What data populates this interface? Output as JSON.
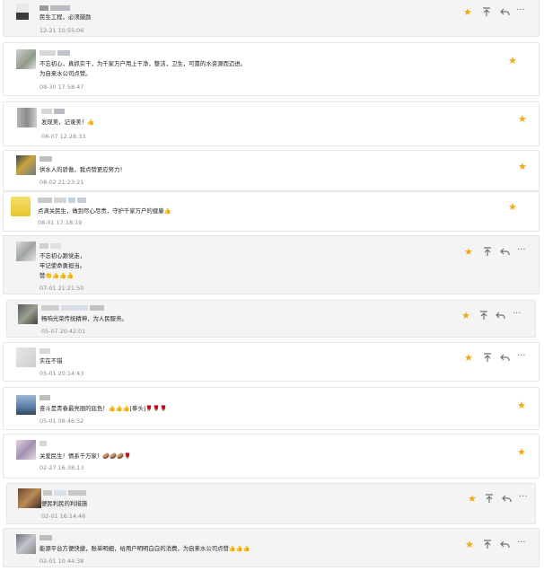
{
  "comments": [
    {
      "text_lines": [
        "民生工程，必须鼓励"
      ],
      "time": "12-21 10:55:06",
      "highlight": true,
      "actions": true
    },
    {
      "text_lines": [
        "不忘初心，真抓实干，为千家万户用上干净，整洁，卫生，可靠的水资源而迈进。",
        "为自来水公司点赞。"
      ],
      "time": "08-30 17:58:47",
      "highlight": false,
      "actions": false
    },
    {
      "text_lines": [
        "发现美，记录美！👍"
      ],
      "time": "08-07 12:28:33",
      "highlight": false,
      "actions": false
    },
    {
      "text_lines": [
        "供水人的骄傲，我点赞更应努力！"
      ],
      "time": "08-02 21:23:21",
      "highlight": false,
      "actions": false
    },
    {
      "text_lines": [
        "点滴关民生，做到尽心尽责，守护千家万户的健康👍"
      ],
      "time": "08-01 17:18:19",
      "highlight": false,
      "actions": false
    },
    {
      "text_lines": [
        "不忘初心跟党走，",
        "牢记使命勇担当。",
        "赞👏👍👍👍"
      ],
      "time": "07-01 21:21:50",
      "highlight": true,
      "actions": true
    },
    {
      "text_lines": [
        "畅响光荣传统精神，为人民服务。"
      ],
      "time": "05-07 20:42:01",
      "highlight": true,
      "actions": true
    },
    {
      "text_lines": [
        "实在不错"
      ],
      "time": "05-01 20:14:43",
      "highlight": false,
      "actions": true
    },
    {
      "text_lines": [
        "奋斗是青春最亮丽的底色！👍👍👍[拳头]🌹🌹🌹"
      ],
      "time": "05-01 08:46:52",
      "highlight": false,
      "actions": false
    },
    {
      "text_lines": [
        "关爱民生！情系千万家！🥔🥔🥔🌹"
      ],
      "time": "02-27 16:38:13",
      "highlight": false,
      "actions": false
    },
    {
      "text_lines": [
        "便民利民的利措施"
      ],
      "time": "02-01 16:14:46",
      "highlight": true,
      "actions": true
    },
    {
      "text_lines": [
        "能源平台方便快捷，账单明细，给用户明明白白的消费，为自来水公司点赞👍👍👍"
      ],
      "time": "02-01 10:44:38",
      "highlight": true,
      "actions": true
    }
  ],
  "icons": {
    "star": "star-icon",
    "pin": "pin-top-icon",
    "reply": "reply-icon",
    "more": "more-icon"
  },
  "colors": {
    "star": "#f2a816",
    "highlight_bg": "#f4f4f5",
    "timestamp": "#8a8a8a"
  }
}
